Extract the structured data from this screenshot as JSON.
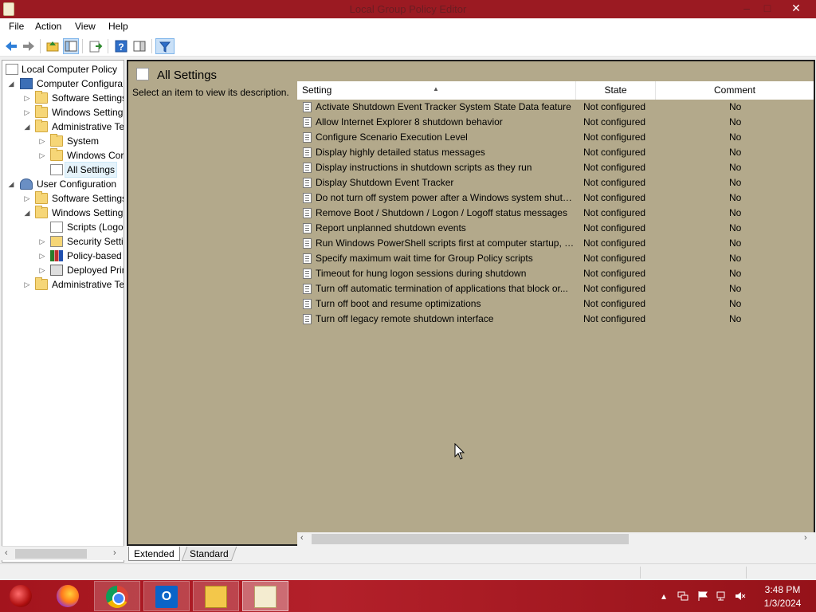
{
  "window": {
    "title": "Local Group Policy Editor",
    "minimize": "–",
    "maximize": "□",
    "close": "✕"
  },
  "menu": [
    "File",
    "Action",
    "View",
    "Help"
  ],
  "toolbar": {
    "icons": [
      "back-arrow-icon",
      "forward-arrow-icon",
      "up-folder-icon",
      "show-hide-tree-icon",
      "export-list-icon",
      "help-icon",
      "show-hide-action-pane-icon",
      "filter-icon"
    ]
  },
  "tree": {
    "root": "Local Computer Policy",
    "items": [
      {
        "label": "Computer Configura",
        "expander": "◢",
        "icon": "computer-icon"
      },
      {
        "label": "Software Settings",
        "expander": "▷",
        "icon": "folder-icon"
      },
      {
        "label": "Windows Setting",
        "expander": "▷",
        "icon": "folder-icon"
      },
      {
        "label": "Administrative Te",
        "expander": "◢",
        "icon": "folder-icon"
      },
      {
        "label": "System",
        "expander": "▷",
        "icon": "folder-icon"
      },
      {
        "label": "Windows Cor",
        "expander": "▷",
        "icon": "folder-icon"
      },
      {
        "label": "All Settings",
        "expander": "",
        "icon": "all-settings-icon"
      },
      {
        "label": "User Configuration",
        "expander": "◢",
        "icon": "user-icon"
      },
      {
        "label": "Software Settings",
        "expander": "▷",
        "icon": "folder-icon"
      },
      {
        "label": "Windows Setting",
        "expander": "◢",
        "icon": "folder-icon"
      },
      {
        "label": "Scripts (Logon",
        "expander": "",
        "icon": "document-icon"
      },
      {
        "label": "Security Settin",
        "expander": "▷",
        "icon": "security-icon"
      },
      {
        "label": "Policy-based",
        "expander": "▷",
        "icon": "chart-icon"
      },
      {
        "label": "Deployed Prin",
        "expander": "▷",
        "icon": "printer-icon"
      },
      {
        "label": "Administrative Te",
        "expander": "▷",
        "icon": "folder-icon"
      }
    ]
  },
  "details": {
    "title": "All Settings",
    "description": "Select an item to view its description.",
    "columns": {
      "setting": "Setting",
      "state": "State",
      "comment": "Comment"
    },
    "rows": [
      {
        "setting": "Activate Shutdown Event Tracker System State Data feature",
        "state": "Not configured",
        "comment": "No"
      },
      {
        "setting": "Allow Internet Explorer 8 shutdown behavior",
        "state": "Not configured",
        "comment": "No"
      },
      {
        "setting": "Configure Scenario Execution Level",
        "state": "Not configured",
        "comment": "No"
      },
      {
        "setting": "Display highly detailed status messages",
        "state": "Not configured",
        "comment": "No"
      },
      {
        "setting": "Display instructions in shutdown scripts as they run",
        "state": "Not configured",
        "comment": "No"
      },
      {
        "setting": "Display Shutdown Event Tracker",
        "state": "Not configured",
        "comment": "No"
      },
      {
        "setting": "Do not turn off system power after a Windows system shutd...",
        "state": "Not configured",
        "comment": "No"
      },
      {
        "setting": "Remove Boot / Shutdown / Logon / Logoff status messages",
        "state": "Not configured",
        "comment": "No"
      },
      {
        "setting": "Report unplanned shutdown events",
        "state": "Not configured",
        "comment": "No"
      },
      {
        "setting": "Run Windows PowerShell scripts first at computer startup, s...",
        "state": "Not configured",
        "comment": "No"
      },
      {
        "setting": "Specify maximum wait time for Group Policy scripts",
        "state": "Not configured",
        "comment": "No"
      },
      {
        "setting": "Timeout for hung logon sessions during shutdown",
        "state": "Not configured",
        "comment": "No"
      },
      {
        "setting": "Turn off automatic termination of applications that block or...",
        "state": "Not configured",
        "comment": "No"
      },
      {
        "setting": "Turn off boot and resume optimizations",
        "state": "Not configured",
        "comment": "No"
      },
      {
        "setting": "Turn off legacy remote shutdown interface",
        "state": "Not configured",
        "comment": "No"
      }
    ]
  },
  "tabs": [
    "Extended",
    "Standard"
  ],
  "taskbar": {
    "apps": [
      "firefox-icon",
      "chrome-icon",
      "outlook-icon",
      "file-explorer-icon",
      "group-policy-editor-icon"
    ],
    "outlook_glyph": "O",
    "tray": [
      "show-hidden-icons-arrow",
      "network-sharing-icon",
      "action-center-flag-icon",
      "network-icon",
      "volume-muted-icon"
    ],
    "time": "3:48 PM",
    "date": "1/3/2024"
  },
  "colors": {
    "titlebar": "#9b1a22",
    "details_background": "#b3a98b",
    "taskbar": "#a3141d"
  }
}
